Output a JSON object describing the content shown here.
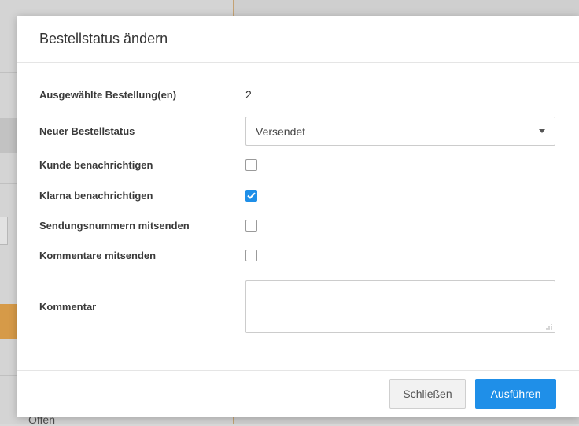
{
  "background": {
    "behind_text": "Offen"
  },
  "modal": {
    "title": "Bestellstatus ändern",
    "rows": {
      "selected_orders": {
        "label": "Ausgewählte Bestellung(en)",
        "value": "2"
      },
      "new_status": {
        "label": "Neuer Bestellstatus",
        "selected": "Versendet"
      },
      "notify_customer": {
        "label": "Kunde benachrichtigen",
        "checked": false
      },
      "notify_klarna": {
        "label": "Klarna benachrichtigen",
        "checked": true
      },
      "send_tracking": {
        "label": "Sendungsnummern mitsenden",
        "checked": false
      },
      "send_comments": {
        "label": "Kommentare mitsenden",
        "checked": false
      },
      "comment": {
        "label": "Kommentar",
        "value": ""
      }
    },
    "footer": {
      "close_label": "Schließen",
      "execute_label": "Ausführen"
    }
  },
  "colors": {
    "accent": "#1f8fe8",
    "checkbox_border": "#9a9a9a"
  }
}
